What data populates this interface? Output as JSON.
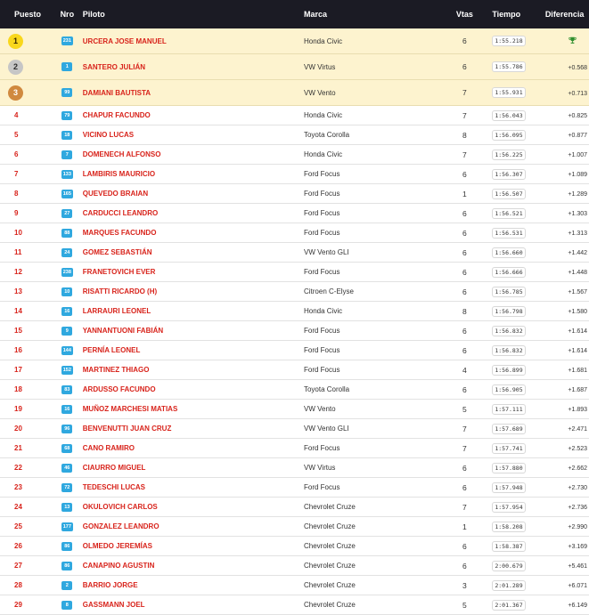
{
  "header": {
    "puesto": "Puesto",
    "nro": "Nro",
    "piloto": "Piloto",
    "marca": "Marca",
    "vtas": "Vtas",
    "tiempo": "Tiempo",
    "diferencia": "Diferencia"
  },
  "colors": {
    "accent_red": "#d8231b",
    "badge_blue": "#2fa8df",
    "header_bg": "#1b1b24",
    "podium_bg": "#fdf3cf",
    "gold": "#f9d71c",
    "silver": "#c6c6c6",
    "bronze": "#d0893f"
  },
  "rows": [
    {
      "puesto": "1",
      "nro": "231",
      "piloto": "URCERA JOSE MANUEL",
      "marca": "Honda Civic",
      "vtas": "6",
      "tiempo": "1:55.218",
      "diferencia": "",
      "icon": "trophy-icon",
      "medal": "gold"
    },
    {
      "puesto": "2",
      "nro": "1",
      "piloto": "SANTERO JULIÁN",
      "marca": "VW Virtus",
      "vtas": "6",
      "tiempo": "1:55.786",
      "diferencia": "+0.568",
      "medal": "silver"
    },
    {
      "puesto": "3",
      "nro": "99",
      "piloto": "DAMIANI BAUTISTA",
      "marca": "VW Vento",
      "vtas": "7",
      "tiempo": "1:55.931",
      "diferencia": "+0.713",
      "medal": "bronze"
    },
    {
      "puesto": "4",
      "nro": "79",
      "piloto": "CHAPUR FACUNDO",
      "marca": "Honda Civic",
      "vtas": "7",
      "tiempo": "1:56.043",
      "diferencia": "+0.825"
    },
    {
      "puesto": "5",
      "nro": "18",
      "piloto": "VICINO LUCAS",
      "marca": "Toyota Corolla",
      "vtas": "8",
      "tiempo": "1:56.095",
      "diferencia": "+0.877"
    },
    {
      "puesto": "6",
      "nro": "7",
      "piloto": "DOMENECH ALFONSO",
      "marca": "Honda Civic",
      "vtas": "7",
      "tiempo": "1:56.225",
      "diferencia": "+1.007"
    },
    {
      "puesto": "7",
      "nro": "133",
      "piloto": "LAMBIRIS MAURICIO",
      "marca": "Ford Focus",
      "vtas": "6",
      "tiempo": "1:56.307",
      "diferencia": "+1.089"
    },
    {
      "puesto": "8",
      "nro": "165",
      "piloto": "QUEVEDO BRAIAN",
      "marca": "Ford Focus",
      "vtas": "1",
      "tiempo": "1:56.507",
      "diferencia": "+1.289"
    },
    {
      "puesto": "9",
      "nro": "27",
      "piloto": "CARDUCCI LEANDRO",
      "marca": "Ford Focus",
      "vtas": "6",
      "tiempo": "1:56.521",
      "diferencia": "+1.303"
    },
    {
      "puesto": "10",
      "nro": "88",
      "piloto": "MARQUES FACUNDO",
      "marca": "Ford Focus",
      "vtas": "6",
      "tiempo": "1:56.531",
      "diferencia": "+1.313"
    },
    {
      "puesto": "11",
      "nro": "24",
      "piloto": "GOMEZ SEBASTIÁN",
      "marca": "VW Vento GLI",
      "vtas": "6",
      "tiempo": "1:56.660",
      "diferencia": "+1.442"
    },
    {
      "puesto": "12",
      "nro": "238",
      "piloto": "FRANETOVICH EVER",
      "marca": "Ford Focus",
      "vtas": "6",
      "tiempo": "1:56.666",
      "diferencia": "+1.448"
    },
    {
      "puesto": "13",
      "nro": "10",
      "piloto": "RISATTI RICARDO (H)",
      "marca": "Citroen C-Elyse",
      "vtas": "6",
      "tiempo": "1:56.785",
      "diferencia": "+1.567"
    },
    {
      "puesto": "14",
      "nro": "16",
      "piloto": "LARRAURI LEONEL",
      "marca": "Honda Civic",
      "vtas": "8",
      "tiempo": "1:56.798",
      "diferencia": "+1.580"
    },
    {
      "puesto": "15",
      "nro": "9",
      "piloto": "YANNANTUONI FABIÁN",
      "marca": "Ford Focus",
      "vtas": "6",
      "tiempo": "1:56.832",
      "diferencia": "+1.614"
    },
    {
      "puesto": "16",
      "nro": "144",
      "piloto": "PERNÍA LEONEL",
      "marca": "Ford Focus",
      "vtas": "6",
      "tiempo": "1:56.832",
      "diferencia": "+1.614"
    },
    {
      "puesto": "17",
      "nro": "152",
      "piloto": "MARTINEZ THIAGO",
      "marca": "Ford Focus",
      "vtas": "4",
      "tiempo": "1:56.899",
      "diferencia": "+1.681"
    },
    {
      "puesto": "18",
      "nro": "83",
      "piloto": "ARDUSSO FACUNDO",
      "marca": "Toyota Corolla",
      "vtas": "6",
      "tiempo": "1:56.905",
      "diferencia": "+1.687"
    },
    {
      "puesto": "19",
      "nro": "16",
      "piloto": "MUÑOZ MARCHESI MATIAS",
      "marca": "VW Vento",
      "vtas": "5",
      "tiempo": "1:57.111",
      "diferencia": "+1.893"
    },
    {
      "puesto": "20",
      "nro": "96",
      "piloto": "BENVENUTTI JUAN CRUZ",
      "marca": "VW Vento GLI",
      "vtas": "7",
      "tiempo": "1:57.689",
      "diferencia": "+2.471"
    },
    {
      "puesto": "21",
      "nro": "68",
      "piloto": "CANO RAMIRO",
      "marca": "Ford Focus",
      "vtas": "7",
      "tiempo": "1:57.741",
      "diferencia": "+2.523"
    },
    {
      "puesto": "22",
      "nro": "46",
      "piloto": "CIAURRO MIGUEL",
      "marca": "VW Virtus",
      "vtas": "6",
      "tiempo": "1:57.880",
      "diferencia": "+2.662"
    },
    {
      "puesto": "23",
      "nro": "72",
      "piloto": "TEDESCHI LUCAS",
      "marca": "Ford Focus",
      "vtas": "6",
      "tiempo": "1:57.948",
      "diferencia": "+2.730"
    },
    {
      "puesto": "24",
      "nro": "13",
      "piloto": "OKULOVICH CARLOS",
      "marca": "Chevrolet Cruze",
      "vtas": "7",
      "tiempo": "1:57.954",
      "diferencia": "+2.736"
    },
    {
      "puesto": "25",
      "nro": "177",
      "piloto": "GONZALEZ LEANDRO",
      "marca": "Chevrolet Cruze",
      "vtas": "1",
      "tiempo": "1:58.208",
      "diferencia": "+2.990"
    },
    {
      "puesto": "26",
      "nro": "86",
      "piloto": "OLMEDO JEREMÍAS",
      "marca": "Chevrolet Cruze",
      "vtas": "6",
      "tiempo": "1:58.387",
      "diferencia": "+3.169"
    },
    {
      "puesto": "27",
      "nro": "86",
      "piloto": "CANAPINO AGUSTIN",
      "marca": "Chevrolet Cruze",
      "vtas": "6",
      "tiempo": "2:00.679",
      "diferencia": "+5.461"
    },
    {
      "puesto": "28",
      "nro": "2",
      "piloto": "BARRIO JORGE",
      "marca": "Chevrolet Cruze",
      "vtas": "3",
      "tiempo": "2:01.289",
      "diferencia": "+6.071"
    },
    {
      "puesto": "29",
      "nro": "8",
      "piloto": "GASSMANN JOEL",
      "marca": "Chevrolet Cruze",
      "vtas": "5",
      "tiempo": "2:01.367",
      "diferencia": "+6.149"
    }
  ]
}
